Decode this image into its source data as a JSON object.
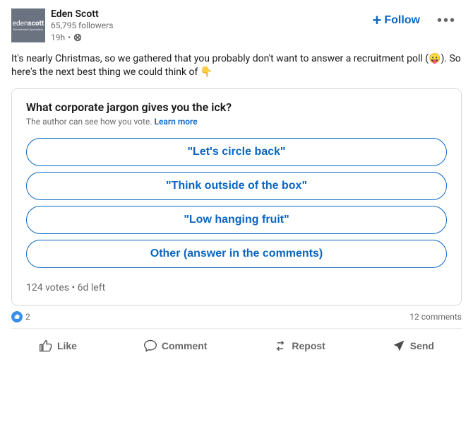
{
  "header": {
    "author": "Eden Scott",
    "followers": "65,795 followers",
    "time": "19h",
    "avatar_text_1": "eden",
    "avatar_text_1b": "scott",
    "avatar_text_2": "Recruitment Specialists"
  },
  "actions": {
    "follow": "Follow",
    "more": "•••"
  },
  "content": "It's nearly Christmas, so we gathered that you probably don't want to answer a recruitment poll (😛). So here's the next best thing we could think of 👇",
  "poll": {
    "question": "What corporate jargon gives you the ick?",
    "hint_text": "The author can see how you vote. ",
    "hint_link": "Learn more",
    "options": [
      "\"Let's circle back\"",
      "\"Think outside of the box\"",
      "\"Low hanging fruit\"",
      "Other (answer in the comments)"
    ],
    "stats": "124 votes • 6d left"
  },
  "social": {
    "reaction_count": "2",
    "comments": "12 comments"
  },
  "bar": {
    "like": "Like",
    "comment": "Comment",
    "repost": "Repost",
    "send": "Send"
  }
}
